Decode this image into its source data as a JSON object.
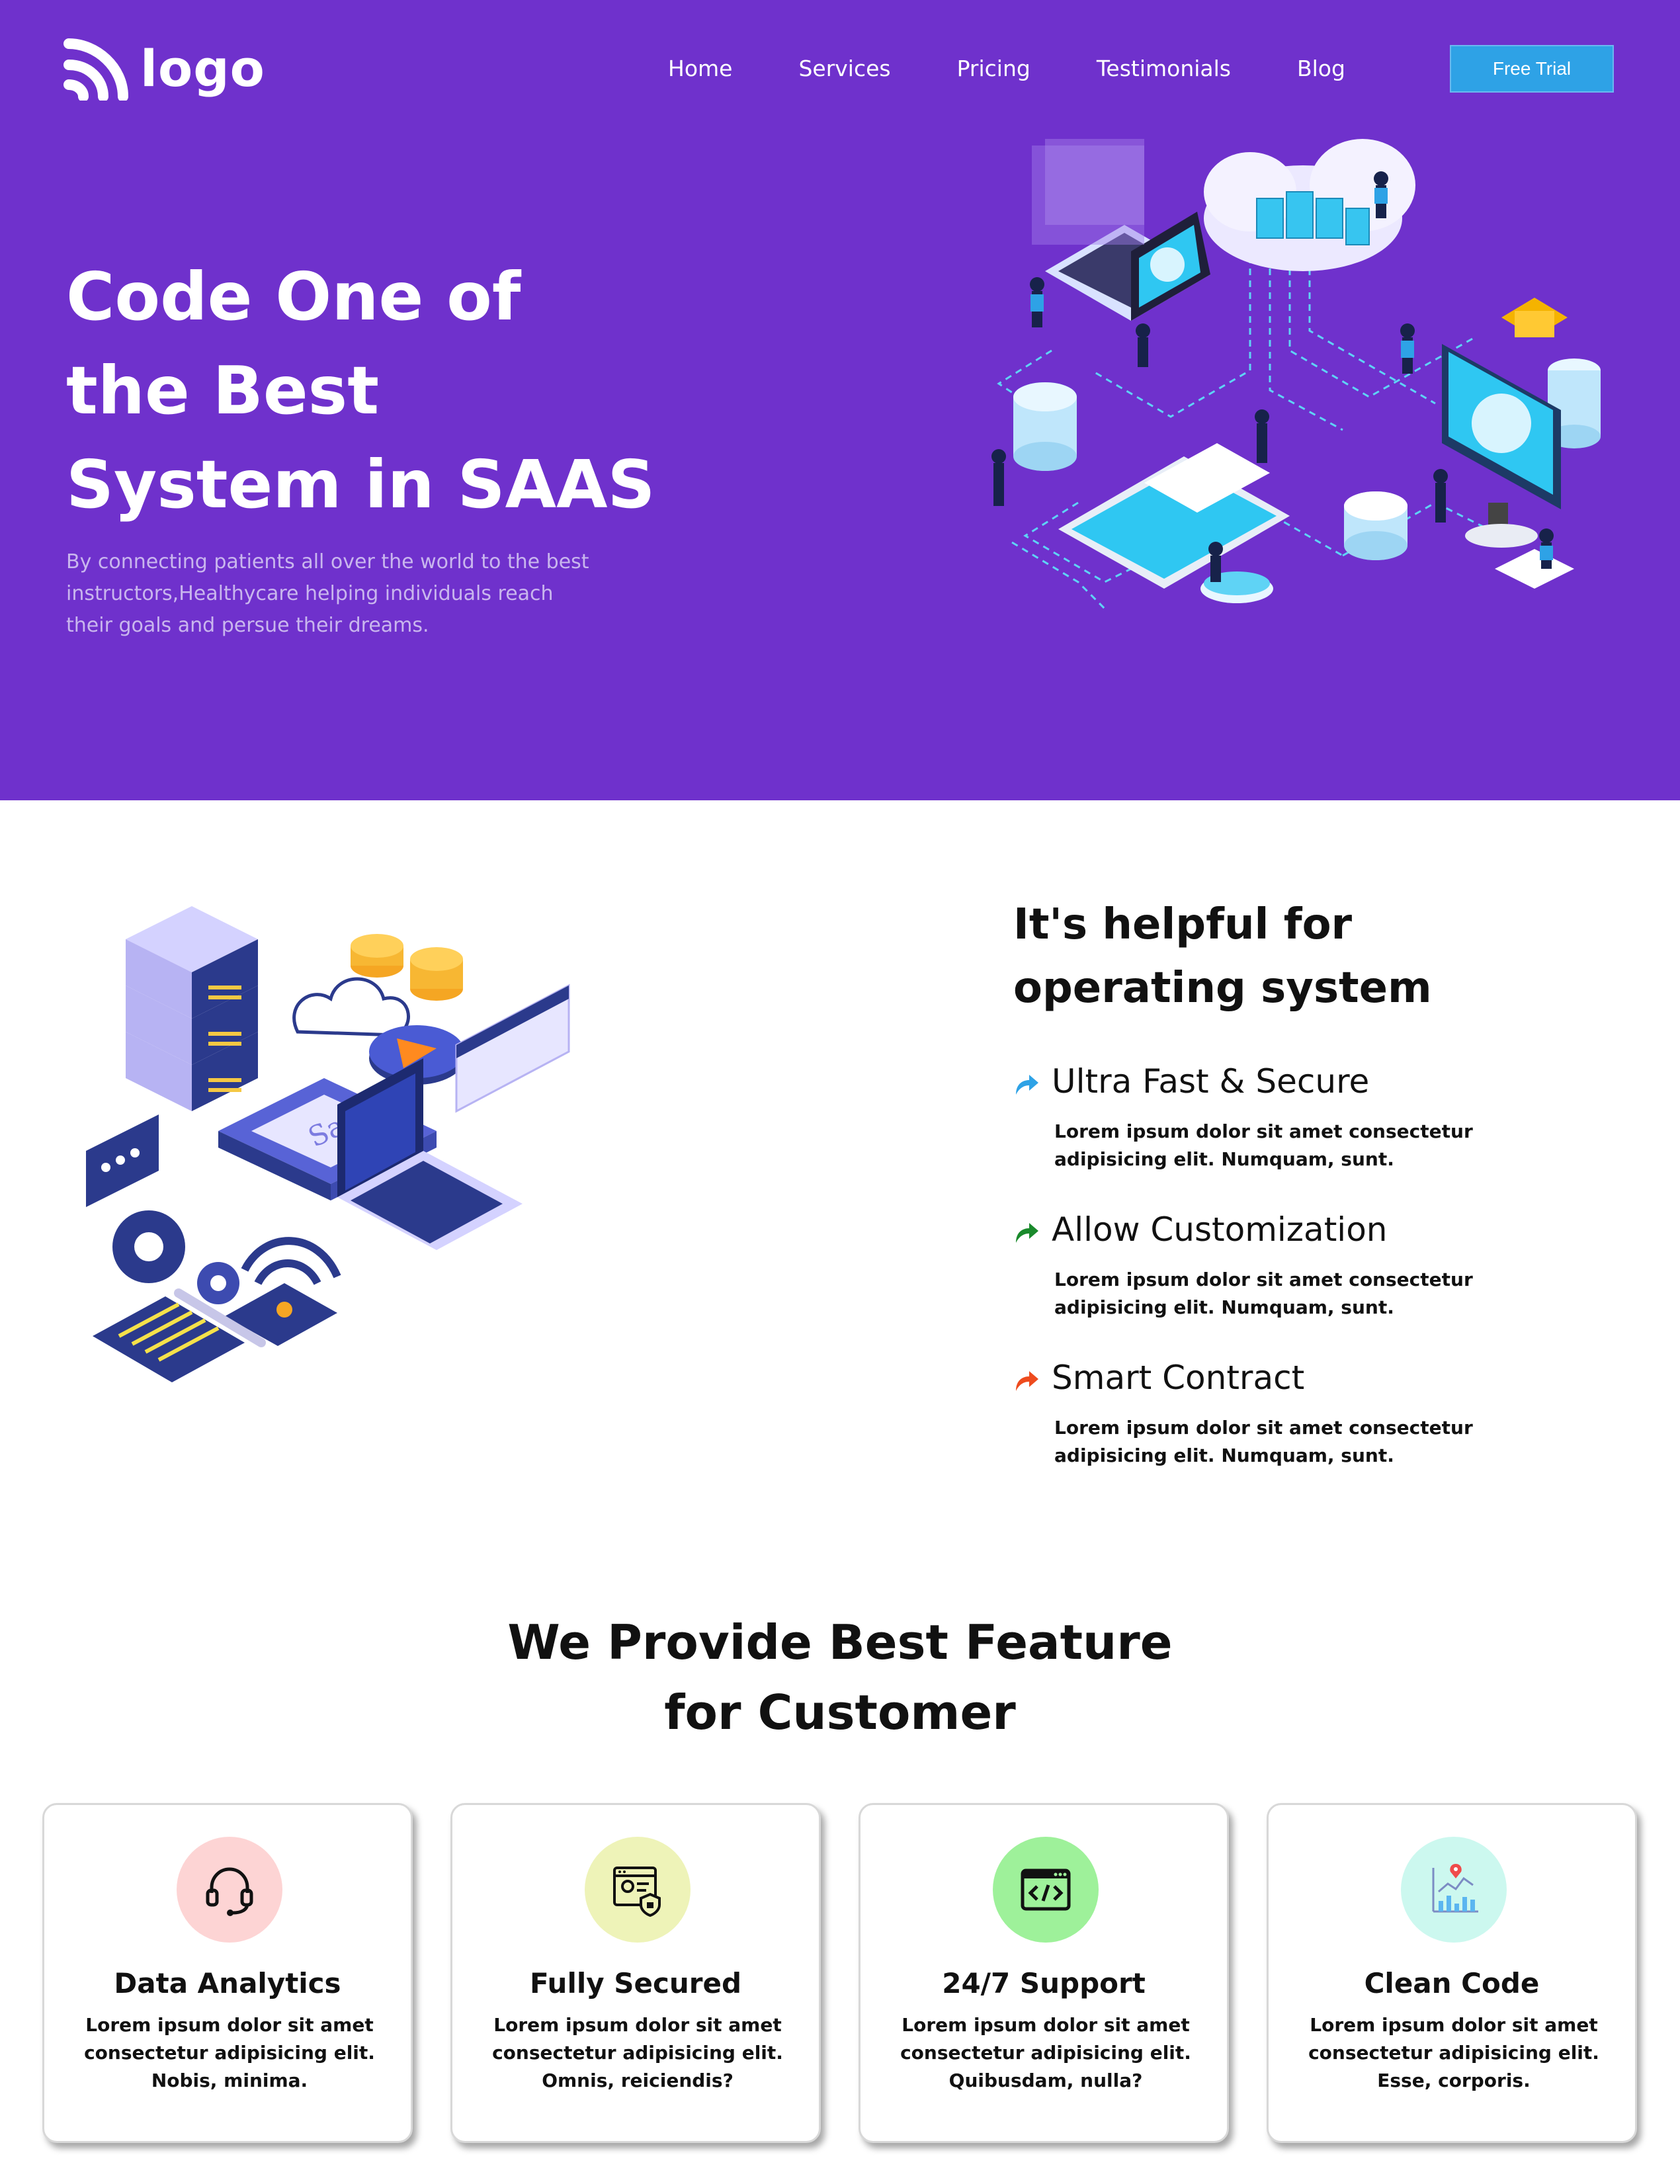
{
  "header": {
    "logo_text": "logo",
    "nav": [
      "Home",
      "Services",
      "Pricing",
      "Testimonials",
      "Blog"
    ],
    "cta_label": "Free Trial"
  },
  "hero": {
    "title_lines": [
      "Code One of",
      "the Best",
      "System in SAAS"
    ],
    "description_lines": [
      "By connecting patients all over the world to the best",
      "instructors,Healthycare helping individuals reach",
      "their goals and persue their dreams."
    ],
    "illustration_icon": "cloud-network-illustration"
  },
  "benefits": {
    "heading_lines": [
      "It's helpful for",
      "operating system"
    ],
    "illustration_icon": "saas-isometric-illustration",
    "items": [
      {
        "title": "Ultra Fast & Secure",
        "desc_lines": [
          "Lorem ipsum dolor sit amet consectetur",
          "adipisicing elit. Numquam, sunt."
        ],
        "arrow_color": "#2ea2e6"
      },
      {
        "title": "Allow Customization",
        "desc_lines": [
          "Lorem ipsum dolor sit amet consectetur",
          "adipisicing elit. Numquam, sunt."
        ],
        "arrow_color": "#1a8a2c"
      },
      {
        "title": "Smart Contract",
        "desc_lines": [
          "Lorem ipsum dolor sit amet consectetur",
          "adipisicing elit. Numquam, sunt."
        ],
        "arrow_color": "#ee4b1e"
      }
    ]
  },
  "features": {
    "heading_lines": [
      "We Provide Best Feature",
      "for Customer"
    ],
    "cards": [
      {
        "title": "Data Analytics",
        "desc_lines": [
          "Lorem ipsum dolor sit amet",
          "consectetur adipisicing elit.",
          "Nobis, minima."
        ],
        "icon": "headset-icon",
        "circle_color": "#fdd4d4"
      },
      {
        "title": "Fully Secured",
        "desc_lines": [
          "Lorem ipsum dolor sit amet",
          "consectetur adipisicing elit.",
          "Omnis, reiciendis?"
        ],
        "icon": "secure-profile-icon",
        "circle_color": "#eef3b8"
      },
      {
        "title": "24/7 Support",
        "desc_lines": [
          "Lorem ipsum dolor sit amet",
          "consectetur adipisicing elit.",
          "Quibusdam, nulla?"
        ],
        "icon": "code-window-icon",
        "circle_color": "#9ef19a"
      },
      {
        "title": "Clean Code",
        "desc_lines": [
          "Lorem ipsum dolor sit amet",
          "consectetur adipisicing elit.",
          "Esse, corporis."
        ],
        "icon": "analytics-chart-icon",
        "circle_color": "#ccf8ef"
      }
    ]
  },
  "colors": {
    "hero_bg": "#6f31cc",
    "cta_bg": "#2ea2e6"
  }
}
